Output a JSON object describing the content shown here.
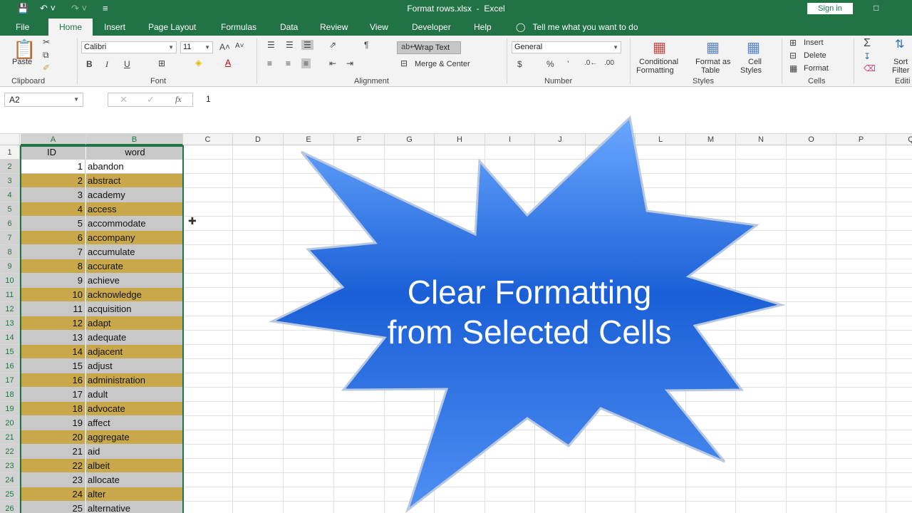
{
  "title": {
    "document": "Format rows.xlsx",
    "separator": "-",
    "app": "Excel",
    "signin": "Sign in"
  },
  "tabs": [
    "File",
    "Home",
    "Insert",
    "Page Layout",
    "Formulas",
    "Data",
    "Review",
    "View",
    "Developer",
    "Help"
  ],
  "tell_me": "Tell me what you want to do",
  "ribbon": {
    "clipboard": {
      "label": "Clipboard",
      "paste": "Paste"
    },
    "font": {
      "label": "Font",
      "name": "Calibri",
      "size": "11"
    },
    "alignment": {
      "label": "Alignment",
      "wrap": "Wrap Text",
      "merge": "Merge & Center"
    },
    "number": {
      "label": "Number",
      "format": "General"
    },
    "styles": {
      "label": "Styles",
      "conditional": "Conditional",
      "conditional2": "Formatting",
      "format_as": "Format as",
      "format_as2": "Table",
      "cell": "Cell",
      "cell2": "Styles"
    },
    "cells": {
      "label": "Cells",
      "insert": "Insert",
      "delete": "Delete",
      "format": "Format"
    },
    "editing": {
      "label": "Editi",
      "sort": "Sort",
      "filter": "Filter"
    }
  },
  "formula_bar": {
    "name_box": "A2",
    "value": "1"
  },
  "columns": [
    "A",
    "B",
    "C",
    "D",
    "E",
    "F",
    "G",
    "H",
    "I",
    "J",
    "K",
    "L",
    "M",
    "N",
    "O",
    "P",
    "Q"
  ],
  "headers": {
    "id": "ID",
    "word": "word"
  },
  "rows": [
    {
      "id": "1",
      "word": "abandon"
    },
    {
      "id": "2",
      "word": "abstract"
    },
    {
      "id": "3",
      "word": "academy"
    },
    {
      "id": "4",
      "word": "access"
    },
    {
      "id": "5",
      "word": "accommodate"
    },
    {
      "id": "6",
      "word": "accompany"
    },
    {
      "id": "7",
      "word": "accumulate"
    },
    {
      "id": "8",
      "word": "accurate"
    },
    {
      "id": "9",
      "word": "achieve"
    },
    {
      "id": "10",
      "word": "acknowledge"
    },
    {
      "id": "11",
      "word": "acquisition"
    },
    {
      "id": "12",
      "word": "adapt"
    },
    {
      "id": "13",
      "word": "adequate"
    },
    {
      "id": "14",
      "word": "adjacent"
    },
    {
      "id": "15",
      "word": "adjust"
    },
    {
      "id": "16",
      "word": "administration"
    },
    {
      "id": "17",
      "word": "adult"
    },
    {
      "id": "18",
      "word": "advocate"
    },
    {
      "id": "19",
      "word": "affect"
    },
    {
      "id": "20",
      "word": "aggregate"
    },
    {
      "id": "21",
      "word": "aid"
    },
    {
      "id": "22",
      "word": "albeit"
    },
    {
      "id": "23",
      "word": "allocate"
    },
    {
      "id": "24",
      "word": "alter"
    },
    {
      "id": "25",
      "word": "alternative"
    }
  ],
  "colors": {
    "excel_green": "#217346",
    "band_gold": "#c8a84b",
    "band_gray": "#c8c8c8",
    "burst_blue": "#1a5fd6"
  },
  "callout": {
    "line1": "Clear Formatting",
    "line2": "from Selected Cells"
  }
}
